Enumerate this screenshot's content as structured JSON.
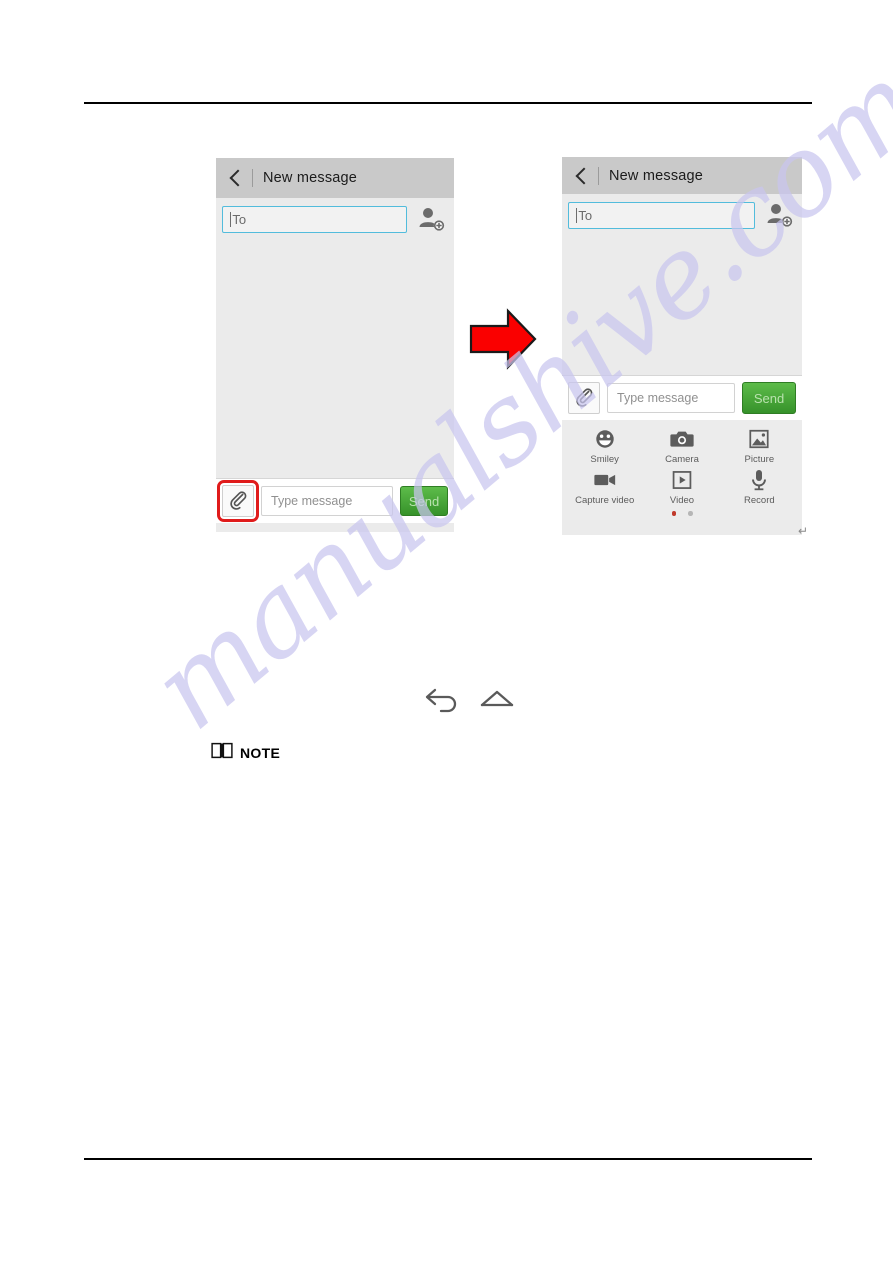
{
  "document": {
    "watermark": "manualshive.com",
    "note_label": "NOTE",
    "return_mark": "↵"
  },
  "screens": [
    {
      "id": "left",
      "titlebar": {
        "title": "New message",
        "back_icon": "chevron-left-icon"
      },
      "to_field": {
        "placeholder": "To",
        "value": ""
      },
      "add_contact_icon": "add-contact-icon",
      "compose": {
        "attach_icon": "paperclip-icon",
        "attach_highlighted": true,
        "highlight_color": "#e01b1b",
        "message_placeholder": "Type message",
        "send_label": "Send",
        "send_color": "#41a630"
      },
      "attachment_panel_open": false
    },
    {
      "id": "right",
      "titlebar": {
        "title": "New message",
        "back_icon": "chevron-left-icon"
      },
      "to_field": {
        "placeholder": "To",
        "value": ""
      },
      "add_contact_icon": "add-contact-icon",
      "compose": {
        "attach_icon": "paperclip-icon",
        "attach_highlighted": false,
        "message_placeholder": "Type message",
        "send_label": "Send",
        "send_color": "#41a630"
      },
      "attachment_panel_open": true,
      "attachment_panel": {
        "items": [
          {
            "label": "Smiley",
            "icon": "smiley-icon"
          },
          {
            "label": "Camera",
            "icon": "camera-icon"
          },
          {
            "label": "Picture",
            "icon": "picture-icon"
          },
          {
            "label": "Capture video",
            "icon": "camcorder-icon"
          },
          {
            "label": "Video",
            "icon": "video-play-icon"
          },
          {
            "label": "Record",
            "icon": "microphone-icon"
          }
        ],
        "pages": 2,
        "active_page": 1,
        "active_dot_color": "#c0392b",
        "inactive_dot_color": "#b6b6b6"
      }
    }
  ],
  "flow_arrow": {
    "icon": "right-arrow-icon",
    "color": "#fa0000"
  },
  "nav_icons": [
    {
      "icon": "back-arrow-icon"
    },
    {
      "icon": "home-icon"
    }
  ]
}
